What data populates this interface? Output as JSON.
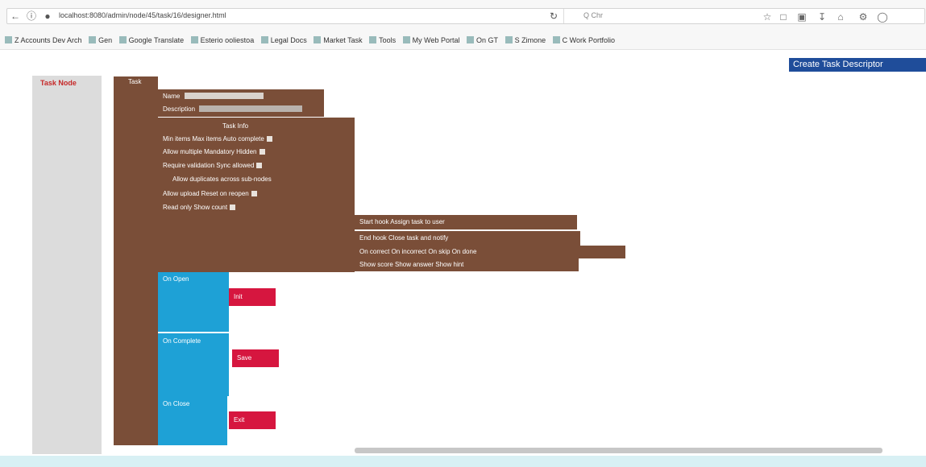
{
  "browser": {
    "url": "localhost:8080/admin/node/45/task/16/designer.html",
    "search_placeholder": "Q  Chr",
    "bookmarks": [
      "Z  Accounts  Dev Arch",
      "Gen",
      "Google Translate",
      "Esterio ooliestoa",
      "Legal Docs",
      "Market Task",
      "Tools",
      "My Web Portal",
      "On GT",
      "S Zimone",
      "C Work Portfolio"
    ]
  },
  "page": {
    "create_button": "Create Task Descriptor",
    "task_node_label": "Task Node",
    "root_block_label": "Task",
    "name_label": "Name",
    "description_label": "Description",
    "section_header": "Task Info",
    "rows": [
      "Min items  Max items  Auto complete",
      "Allow multiple  Mandatory  Hidden",
      "Require validation  Sync allowed",
      "Allow duplicates across sub-nodes",
      "Allow upload  Reset on reopen",
      "Read only  Show count"
    ],
    "right_rows": [
      "Start hook  Assign task to user",
      "End hook  Close task and notify",
      "On correct  On incorrect  On skip  On done",
      "Show score  Show answer  Show hint"
    ],
    "actions": [
      {
        "label": "On Open",
        "value": "Init"
      },
      {
        "label": "On Complete",
        "value": "Save"
      },
      {
        "label": "On Close",
        "value": "Exit"
      }
    ]
  },
  "colors": {
    "brown": "#7a4e38",
    "blue": "#1ea1d6",
    "red": "#d6163f",
    "create_button_bg": "#1f4d9a",
    "task_node_label": "#c62828"
  }
}
